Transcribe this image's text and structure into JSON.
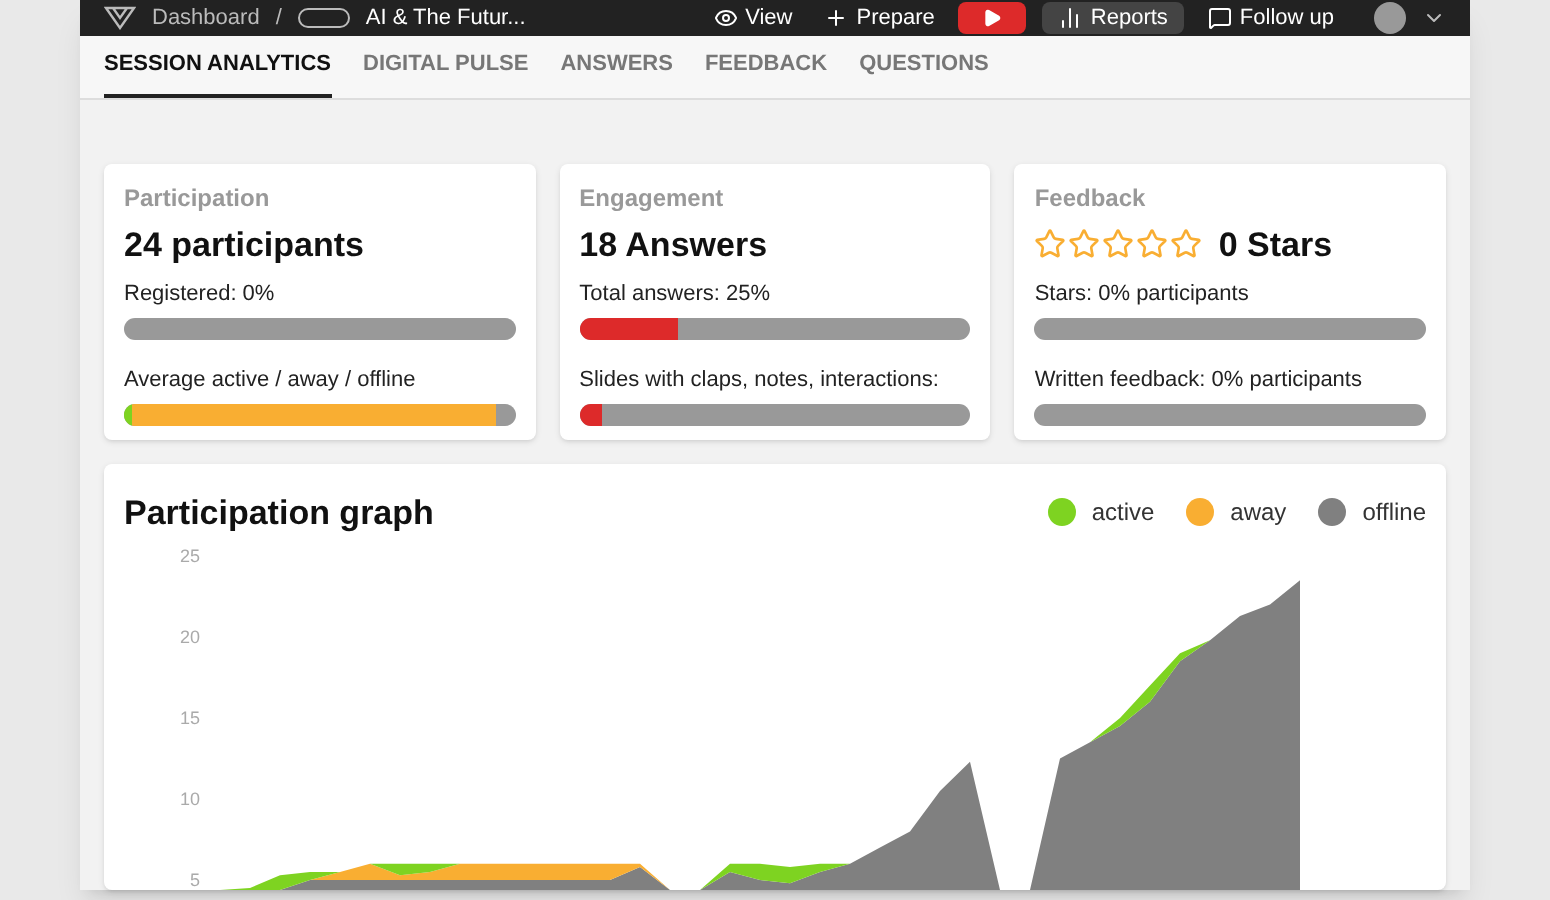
{
  "top_bar": {
    "breadcrumb": [
      "Dashboard",
      "/"
    ],
    "session_title": "AI & The Futur...",
    "actions": [
      {
        "kind": "view",
        "label": "View"
      },
      {
        "kind": "prepare",
        "label": "Prepare"
      },
      {
        "kind": "live"
      },
      {
        "kind": "reports",
        "label": "Reports"
      },
      {
        "kind": "follow",
        "label": "Follow up"
      }
    ]
  },
  "tabs": [
    {
      "label": "SESSION ANALYTICS",
      "selected": true
    },
    {
      "label": "DIGITAL PULSE",
      "selected": false
    },
    {
      "label": "ANSWERS",
      "selected": false
    },
    {
      "label": "FEEDBACK",
      "selected": false
    },
    {
      "label": "QUESTIONS",
      "selected": false
    }
  ],
  "cards": [
    {
      "title": "Participation",
      "headline": "24 participants",
      "meters": [
        {
          "label": "Registered: 0%"
        },
        {
          "label": "Average active / away / offline",
          "segments": [
            {
              "level": 0.02,
              "color": "#7ed321"
            },
            {
              "level": 0.93,
              "color": "#f9ae32"
            }
          ]
        }
      ]
    },
    {
      "title": "Engagement",
      "headline": "18 Answers",
      "meters": [
        {
          "label": "Total answers: 25%",
          "level": 0.25,
          "color": "#dd2a2a"
        },
        {
          "label": "Slides with claps, notes, interactions:",
          "level": 0.06,
          "color": "#dd2a2a"
        }
      ]
    },
    {
      "title": "Feedback",
      "headline": "0 Stars",
      "stars": 0,
      "meters": [
        {
          "label": "Stars: 0% participants"
        },
        {
          "label": "Written feedback: 0% participants"
        }
      ]
    }
  ],
  "graph": {
    "title": "Participation graph",
    "legend": [
      {
        "label": "active",
        "color": "#7ed321"
      },
      {
        "label": "away",
        "color": "#f9ae32"
      },
      {
        "label": "offline",
        "color": "#808080"
      }
    ],
    "y_ticks": [
      "25",
      "20",
      "15",
      "10",
      "5"
    ]
  }
}
